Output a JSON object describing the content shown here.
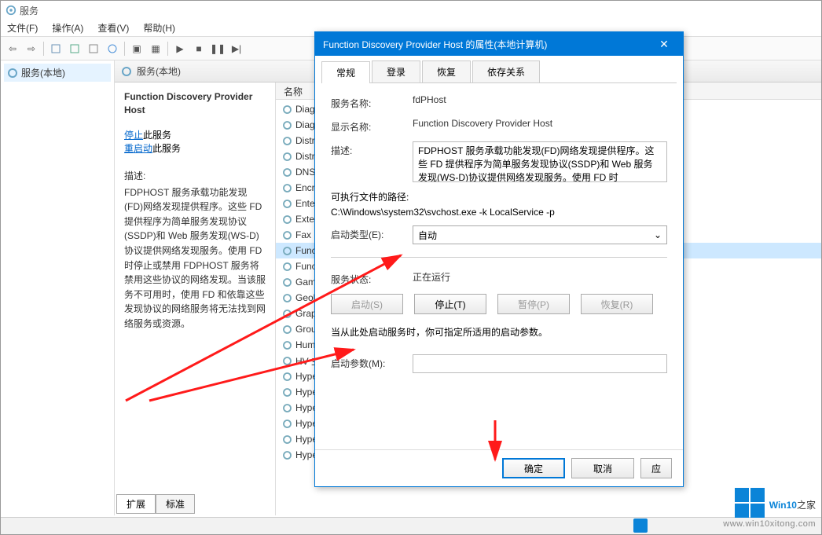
{
  "mmc": {
    "title": "服务",
    "menu": [
      "文件(F)",
      "操作(A)",
      "查看(V)",
      "帮助(H)"
    ],
    "tree_item": "服务(本地)",
    "center_header": "服务(本地)",
    "detail": {
      "service_name": "Function Discovery Provider Host",
      "stop_link": "停止",
      "stop_suffix": "此服务",
      "restart_link": "重启动",
      "restart_suffix": "此服务",
      "desc_label": "描述:",
      "description": "FDPHOST 服务承载功能发现(FD)网络发现提供程序。这些 FD 提供程序为简单服务发现协议(SSDP)和 Web 服务发现(WS-D)协议提供网络发现服务。使用 FD 时停止或禁用 FDPHOST 服务将禁用这些协议的网络发现。当该服务不可用时，使用 FD 和依靠这些发现协议的网络服务将无法找到网络服务或资源。"
    },
    "list_header": "名称",
    "services": [
      "Diagno",
      "Diagno",
      "Distribu",
      "Distribu",
      "DNS Cli",
      "Encrypt",
      "Enterpri",
      "Extensib",
      "Fax",
      "Function",
      "Function",
      "GameD",
      "Geoloca",
      "Graphic",
      "Group I",
      "Human",
      "HV 主机",
      "Hyper-V",
      "Hyper-V",
      "Hyper-V",
      "Hyper-V",
      "Hyper-V",
      "Hyper-V"
    ],
    "sel_index": 9,
    "bottom_tabs": [
      "扩展",
      "标准"
    ]
  },
  "dialog": {
    "title": "Function Discovery Provider Host 的属性(本地计算机)",
    "tabs": [
      "常规",
      "登录",
      "恢复",
      "依存关系"
    ],
    "labels": {
      "svc_name": "服务名称:",
      "disp_name": "显示名称:",
      "desc": "描述:",
      "exe_path": "可执行文件的路径:",
      "startup": "启动类型(E):",
      "status": "服务状态:",
      "param_hint": "当从此处启动服务时，你可指定所适用的启动参数。",
      "start_param": "启动参数(M):"
    },
    "values": {
      "svc_name": "fdPHost",
      "disp_name": "Function Discovery Provider Host",
      "desc": "FDPHOST 服务承载功能发现(FD)网络发现提供程序。这些 FD 提供程序为简单服务发现协议(SSDP)和 Web 服务发现(WS-D)协议提供网络发现服务。使用 FD 时",
      "exe_path": "C:\\Windows\\system32\\svchost.exe -k LocalService -p",
      "startup": "自动",
      "status": "正在运行"
    },
    "buttons": {
      "start": "启动(S)",
      "stop": "停止(T)",
      "pause": "暂停(P)",
      "resume": "恢复(R)",
      "ok": "确定",
      "cancel": "取消",
      "apply": "应"
    }
  },
  "watermark": {
    "brand_a": "Win10",
    "brand_b": "之家",
    "url": "www.win10xitong.com"
  }
}
